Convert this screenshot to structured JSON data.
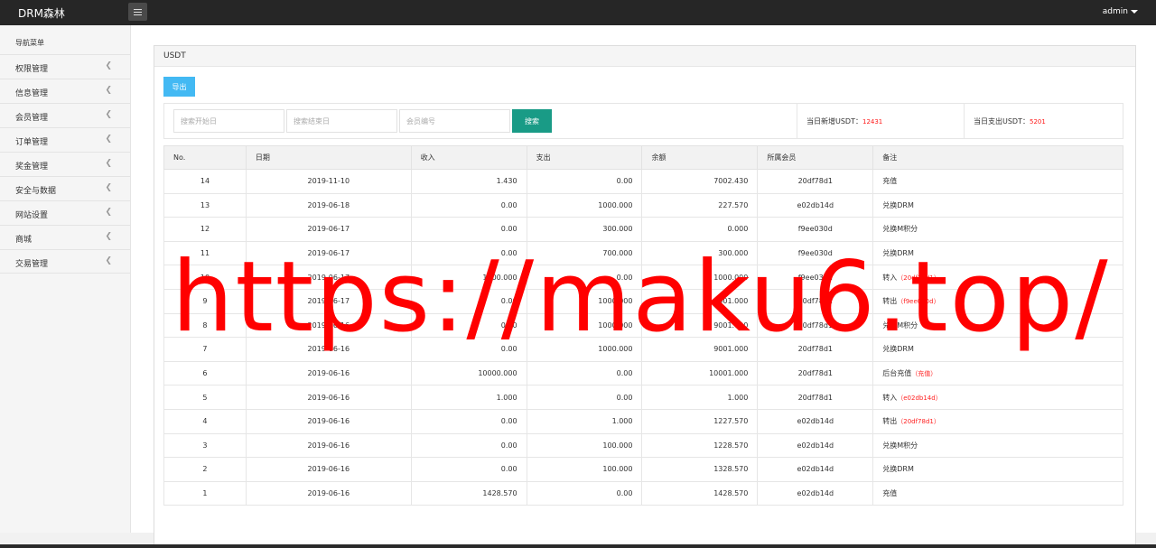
{
  "app": {
    "brand": "DRM森林",
    "user": "admin"
  },
  "sidebar": {
    "header": "导航菜单",
    "items": [
      {
        "label": "权限管理"
      },
      {
        "label": "信息管理"
      },
      {
        "label": "会员管理"
      },
      {
        "label": "订单管理"
      },
      {
        "label": "奖金管理"
      },
      {
        "label": "安全与数据"
      },
      {
        "label": "网站设置"
      },
      {
        "label": "商城"
      },
      {
        "label": "交易管理"
      }
    ]
  },
  "panel": {
    "title": "USDT",
    "export_label": "导出"
  },
  "filters": {
    "start_date_placeholder": "搜索开始日",
    "end_date_placeholder": "搜索结束日",
    "member_placeholder": "会员编号",
    "search_label": "搜索"
  },
  "stats": {
    "income_label": "当日新增USDT：",
    "income_value": "12431",
    "expense_label": "当日支出USDT：",
    "expense_value": "5201"
  },
  "table": {
    "columns": [
      "No.",
      "日期",
      "收入",
      "支出",
      "余额",
      "所属会员",
      "备注"
    ],
    "rows": [
      [
        "14",
        "2019-11-10",
        "1.430",
        "0.00",
        "7002.430",
        "20df78d1",
        "充值",
        ""
      ],
      [
        "13",
        "2019-06-18",
        "0.00",
        "1000.000",
        "227.570",
        "e02db14d",
        "兑换DRM",
        ""
      ],
      [
        "12",
        "2019-06-17",
        "0.00",
        "300.000",
        "0.000",
        "f9ee030d",
        "兑换M积分",
        ""
      ],
      [
        "11",
        "2019-06-17",
        "0.00",
        "700.000",
        "300.000",
        "f9ee030d",
        "兑换DRM",
        ""
      ],
      [
        "10",
        "2019-06-17",
        "1000.000",
        "0.00",
        "1000.000",
        "f9ee030d",
        "转入",
        "（20df78d1）"
      ],
      [
        "9",
        "2019-06-17",
        "0.00",
        "1000.000",
        "8001.000",
        "20df78d1",
        "转出",
        "（f9ee030d）"
      ],
      [
        "8",
        "2019-06-16",
        "0.00",
        "1000.000",
        "9001.000",
        "20df78d1",
        "兑换M积分",
        ""
      ],
      [
        "7",
        "2019-06-16",
        "0.00",
        "1000.000",
        "9001.000",
        "20df78d1",
        "兑换DRM",
        ""
      ],
      [
        "6",
        "2019-06-16",
        "10000.000",
        "0.00",
        "10001.000",
        "20df78d1",
        "后台充值",
        "（充值）"
      ],
      [
        "5",
        "2019-06-16",
        "1.000",
        "0.00",
        "1.000",
        "20df78d1",
        "转入",
        "（e02db14d）"
      ],
      [
        "4",
        "2019-06-16",
        "0.00",
        "1.000",
        "1227.570",
        "e02db14d",
        "转出",
        "（20df78d1）"
      ],
      [
        "3",
        "2019-06-16",
        "0.00",
        "100.000",
        "1228.570",
        "e02db14d",
        "兑换M积分",
        ""
      ],
      [
        "2",
        "2019-06-16",
        "0.00",
        "100.000",
        "1328.570",
        "e02db14d",
        "兑换DRM",
        ""
      ],
      [
        "1",
        "2019-06-16",
        "1428.570",
        "0.00",
        "1428.570",
        "e02db14d",
        "充值",
        ""
      ]
    ]
  },
  "watermark": "https://maku6.top/",
  "colors": {
    "topbar": "#262626",
    "export_button": "#43b9f3",
    "search_button": "#199b86",
    "highlight_text": "#ff1919",
    "watermark": "#ff0000"
  }
}
